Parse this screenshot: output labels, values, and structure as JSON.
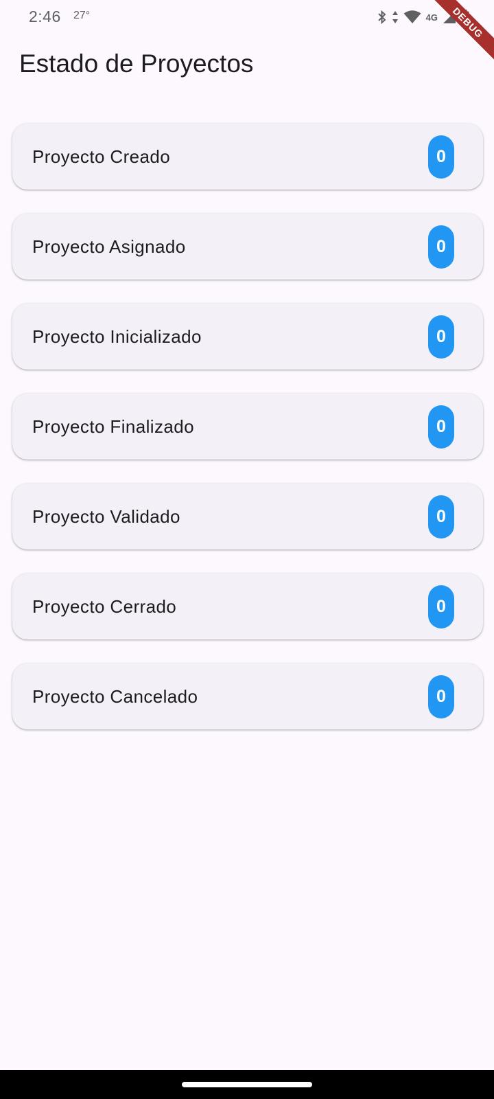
{
  "status_bar": {
    "time": "2:46",
    "temperature": "27°",
    "network": "4G",
    "icons": [
      "bluetooth-icon",
      "data-arrows-icon",
      "wifi-icon",
      "cell-signal-icon",
      "battery-icon"
    ]
  },
  "debug_banner": "DEBUG",
  "page": {
    "title": "Estado de Proyectos"
  },
  "statuses": [
    {
      "label": "Proyecto Creado",
      "count": "0"
    },
    {
      "label": "Proyecto Asignado",
      "count": "0"
    },
    {
      "label": "Proyecto Inicializado",
      "count": "0"
    },
    {
      "label": "Proyecto Finalizado",
      "count": "0"
    },
    {
      "label": "Proyecto Validado",
      "count": "0"
    },
    {
      "label": "Proyecto Cerrado",
      "count": "0"
    },
    {
      "label": "Proyecto Cancelado",
      "count": "0"
    }
  ],
  "colors": {
    "background": "#FDF7FE",
    "card": "#F4F0F7",
    "badge": "#2196F3",
    "debug_ribbon": "#A8302C"
  }
}
